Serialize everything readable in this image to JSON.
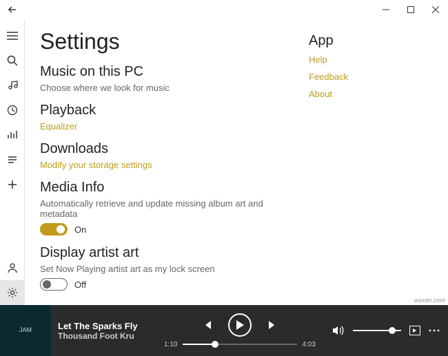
{
  "titlebar": {
    "back": "←"
  },
  "page": {
    "title": "Settings"
  },
  "music_pc": {
    "title": "Music on this PC",
    "subtitle": "Choose where we look for music"
  },
  "playback": {
    "title": "Playback",
    "link": "Equalizer"
  },
  "downloads": {
    "title": "Downloads",
    "link": "Modify your storage settings"
  },
  "media_info": {
    "title": "Media Info",
    "subtitle": "Automatically retrieve and update missing album art and metadata",
    "toggle_label": "On"
  },
  "artist_art": {
    "title": "Display artist art",
    "subtitle": "Set Now Playing artist art as my lock screen",
    "toggle_label": "Off"
  },
  "app": {
    "title": "App",
    "help": "Help",
    "feedback": "Feedback",
    "about": "About"
  },
  "player": {
    "track_title": "Let The Sparks Fly",
    "track_artist": "Thousand Foot Kru",
    "album_text": "JAM",
    "time_current": "1:10",
    "time_total": "4:03"
  },
  "watermark": "wsxdn.com"
}
